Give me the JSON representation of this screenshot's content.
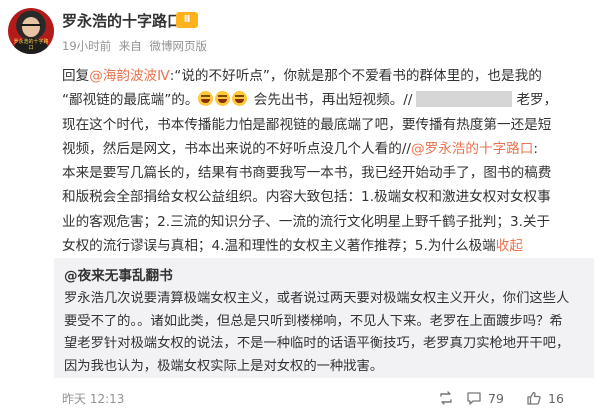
{
  "header": {
    "username": "罗永浩的十字路口",
    "badge": "Ⅱ",
    "avatar_caption": "罗永浩的十字路口",
    "time": "19小时前",
    "source_prefix": "来自",
    "source": "微博网页版"
  },
  "content": {
    "lines": [
      {
        "pre": "回复",
        "mention": "@海韵波波Ⅳ",
        "post": ":“说的不好听点”，你就是那个不爱看书的群体里的，也是我的"
      },
      {
        "text": "“鄙视链的最底端”的。",
        "after_emoji": "会先出书，再出短视频。//",
        "after_redact": "老罗，"
      },
      {
        "text": "现在这个时代，书本传播能力怕是鄙视链的最底端了吧，要传播有热度第一还是短"
      },
      {
        "pre": "视频，然后是网文，书本出来说的不好听点没几个人看的//",
        "mention": "@罗永浩的十字路口",
        "post": ":"
      },
      {
        "text": "本来是要写几篇长的，结果有书商要我写一本书，我已经开始动手了，图书的稿费"
      },
      {
        "text": "和版税会全部捐给女权公益组织。内容大致包括：1.极端女权和激进女权对女权事"
      },
      {
        "text": "业的客观危害；2.三流的知识分子、一流的流行文化明星上野千鹤子批判；3.关于"
      },
      {
        "pre": "女权的流行谬误与真相；4.温和理性的女权主义著作推荐；5.为什么极端",
        "mention": "收起",
        "post": ""
      }
    ]
  },
  "quote": {
    "author": "@夜来无事乱翻书",
    "lines": [
      "罗永浩几次说要清算极端女权主义，或者说过两天要对极端女权主义开火，你们这些人",
      "要受不了的。。诸如此类，但总是只听到楼梯响，不见人下来。老罗在上面踱步吗？希",
      "望老罗针对极端女权的说法，不是一种临时的话语平衡技巧，老罗真刀实枪地开干吧，",
      "因为我也认为，极端女权实际上是对女权的一种戕害。"
    ]
  },
  "footer": {
    "time": "昨天 12:13",
    "comments": "79",
    "likes": "16"
  },
  "colors": {
    "link": "#eb7350",
    "quote_bg": "#f2f2f5",
    "meta": "#939393",
    "badge": "#ffb21c"
  },
  "icons": [
    "repost-icon",
    "comment-icon",
    "like-icon",
    "laughing-emoji-icon"
  ]
}
